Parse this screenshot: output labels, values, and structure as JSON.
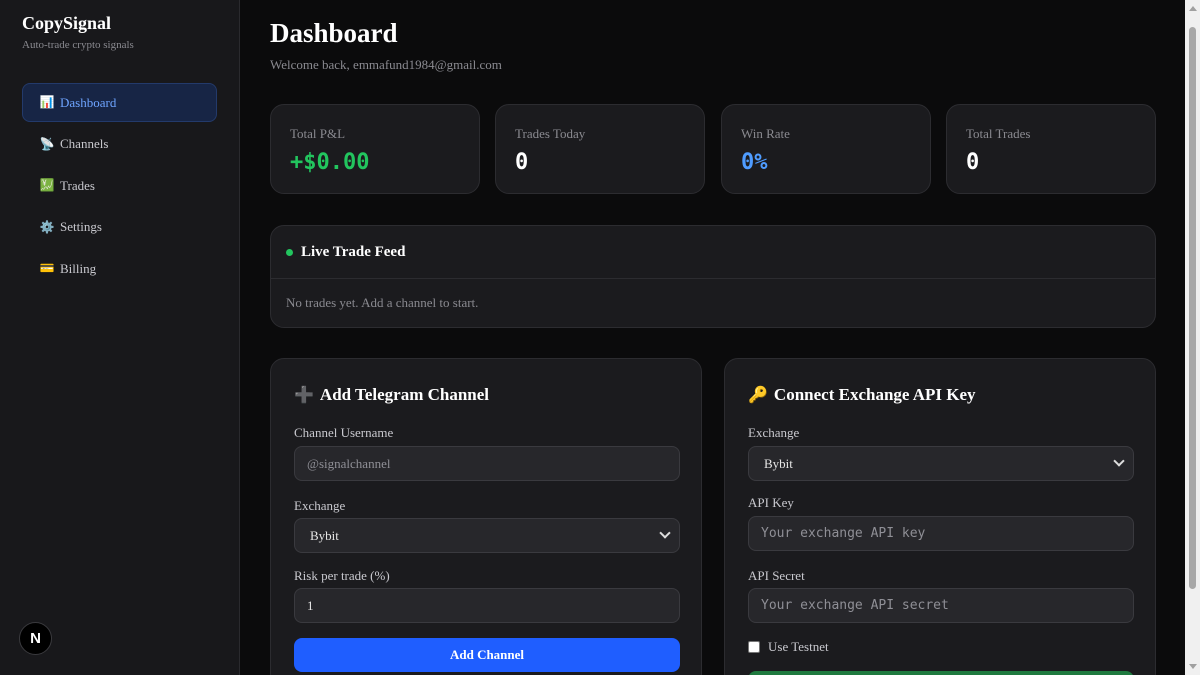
{
  "brand": {
    "title": "CopySignal",
    "subtitle": "Auto-trade crypto signals"
  },
  "sidebar": {
    "items": [
      {
        "label": "Dashboard",
        "icon": "📊",
        "active": true
      },
      {
        "label": "Channels",
        "icon": "📡"
      },
      {
        "label": "Trades",
        "icon": "💹"
      },
      {
        "label": "Settings",
        "icon": "⚙️"
      },
      {
        "label": "Billing",
        "icon": "💳"
      }
    ],
    "nextjs_badge": "N"
  },
  "header": {
    "title": "Dashboard",
    "welcome": "Welcome back, emmafund1984@gmail.com"
  },
  "stats": [
    {
      "label": "Total P&L",
      "value": "+$0.00",
      "color": "#22c55e"
    },
    {
      "label": "Trades Today",
      "value": "0"
    },
    {
      "label": "Win Rate",
      "value": "0%",
      "color": "#4f9cff"
    },
    {
      "label": "Total Trades",
      "value": "0"
    }
  ],
  "feed": {
    "title": "Live Trade Feed",
    "empty": "No trades yet. Add a channel to start."
  },
  "channel_form": {
    "icon": "➕",
    "title": "Add Telegram Channel",
    "username_label": "Channel Username",
    "username_placeholder": "@signalchannel",
    "exchange_label": "Exchange",
    "exchange_value": "Bybit",
    "risk_label": "Risk per trade (%)",
    "risk_value": "1",
    "submit_label": "Add Channel"
  },
  "api_form": {
    "icon": "🔑",
    "title": "Connect Exchange API Key",
    "exchange_label": "Exchange",
    "exchange_value": "Bybit",
    "key_label": "API Key",
    "key_placeholder": "Your exchange API key",
    "secret_label": "API Secret",
    "secret_placeholder": "Your exchange API secret",
    "testnet_label": "Use Testnet"
  }
}
